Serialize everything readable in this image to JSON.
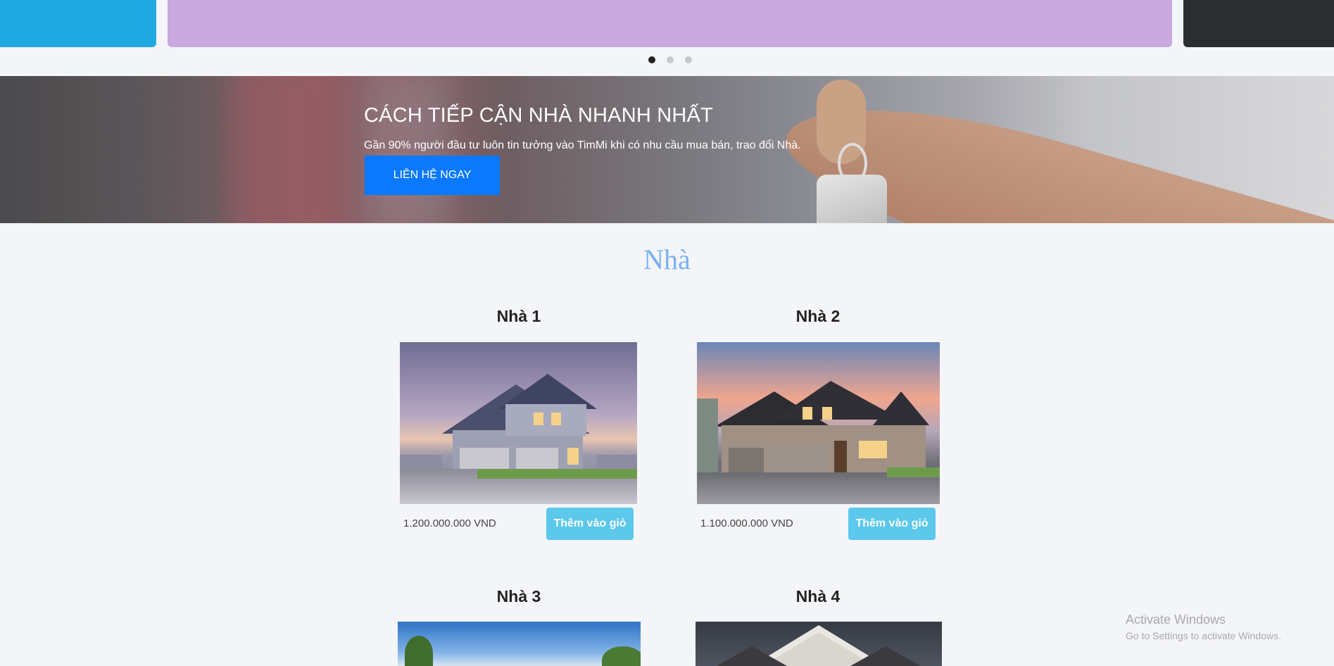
{
  "carousel": {
    "slides": [
      {
        "color": "#1eaae1"
      },
      {
        "color": "#c8a9e0"
      },
      {
        "color": "#2c2d30"
      }
    ],
    "active_index": 0,
    "dot_count": 3
  },
  "banner": {
    "title": "CÁCH TIẾP CẬN NHÀ NHANH NHẤT",
    "subtitle": "Gần 90% người đầu tư luôn tin tưởng vào TimMi khi có nhu cầu mua bán, trao đổi Nhà.",
    "button_label": "LIÊN HỆ NGAY",
    "button_color": "#0a79ff"
  },
  "section": {
    "title": "Nhà",
    "title_color": "#7ab0f2"
  },
  "products": [
    {
      "title": "Nhà 1",
      "price": "1.200.000.000 VND",
      "button_label": "Thêm vào giỏ"
    },
    {
      "title": "Nhà 2",
      "price": "1.100.000.000 VND",
      "button_label": "Thêm vào giỏ"
    },
    {
      "title": "Nhà 3"
    },
    {
      "title": "Nhà 4"
    }
  ],
  "cart_button_color": "#5bc8ec",
  "os_watermark": {
    "line1": "Activate Windows",
    "line2": "Go to Settings to activate Windows."
  }
}
